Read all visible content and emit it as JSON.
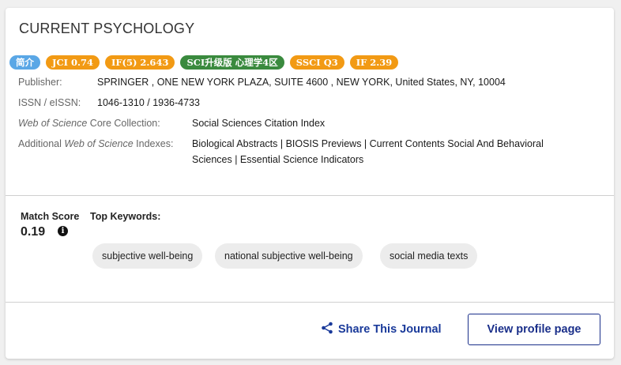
{
  "journal": {
    "title": "CURRENT PSYCHOLOGY"
  },
  "badges": [
    {
      "label": "简介",
      "color": "#5aa7e6"
    },
    {
      "label": "JCI 0.74",
      "color": "#f29a14"
    },
    {
      "label": "IF(5) 2.643",
      "color": "#f29a14"
    },
    {
      "label": "SCI升级版 心理学4区",
      "color": "#3a8a3e"
    },
    {
      "label": "SSCI Q3",
      "color": "#f29a14"
    },
    {
      "label": "IF 2.39",
      "color": "#f29a14"
    }
  ],
  "info": {
    "publisher_label": "Publisher:",
    "publisher_value": "SPRINGER , ONE NEW YORK PLAZA, SUITE 4600 , NEW YORK, United States, NY, 10004",
    "issn_label": "ISSN / eISSN:",
    "issn_value": "1046-1310 / 1936-4733",
    "wos_label_italic": "Web of Science",
    "wos_label_rest": " Core Collection:",
    "wos_value": "Social Sciences Citation Index",
    "additional_label_pre": "Additional ",
    "additional_label_italic": "Web of Science",
    "additional_label_post": " Indexes:",
    "additional_value_line1": "Biological Abstracts | BIOSIS Previews | Current Contents Social And Behavioral",
    "additional_value_line2": "Sciences | Essential Science Indicators"
  },
  "match": {
    "label": "Match Score",
    "value": "0.19",
    "info_icon": "info-icon"
  },
  "keywords": {
    "label": "Top Keywords:",
    "items": [
      "subjective well-being",
      "national subjective well-being",
      "social media texts"
    ]
  },
  "actions": {
    "share_label": "Share This Journal",
    "share_icon": "share-icon",
    "profile_label": "View profile page",
    "accent_color": "#1a2f8a"
  }
}
